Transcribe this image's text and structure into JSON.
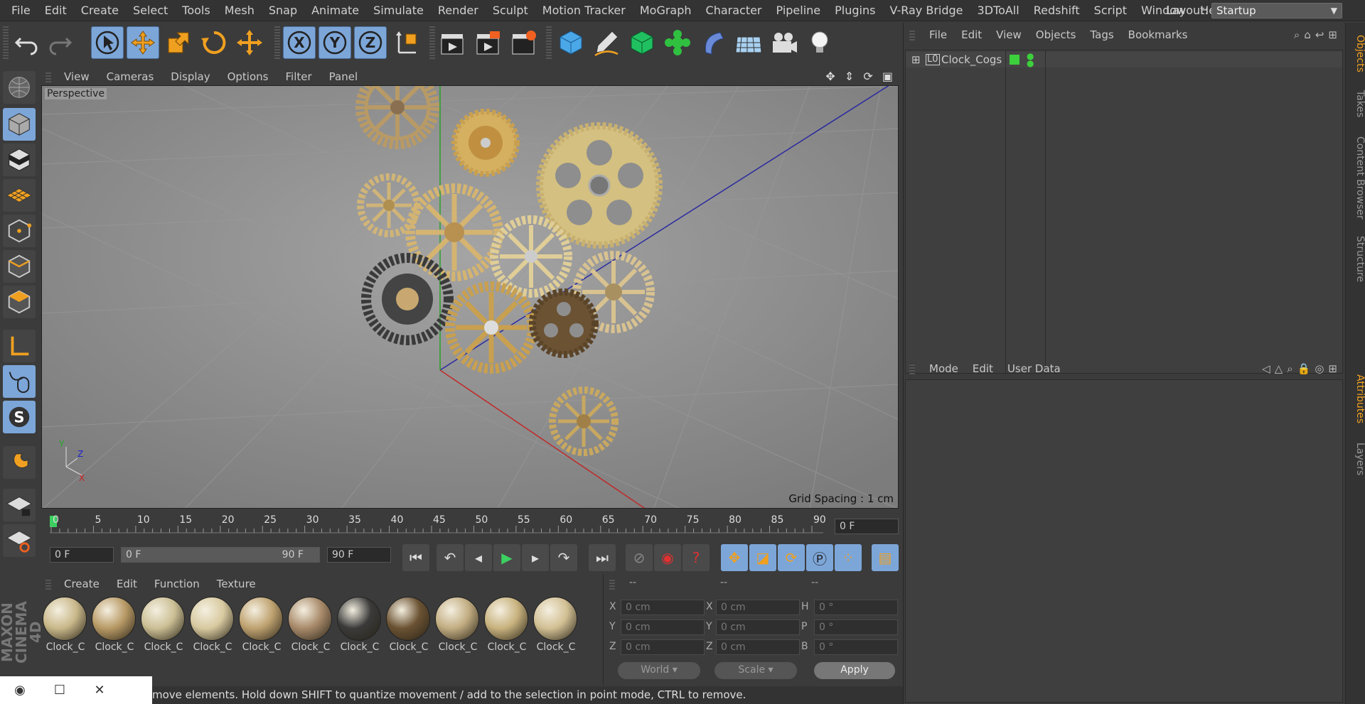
{
  "menubar": {
    "items": [
      "File",
      "Edit",
      "Create",
      "Select",
      "Tools",
      "Mesh",
      "Snap",
      "Animate",
      "Simulate",
      "Render",
      "Sculpt",
      "Motion Tracker",
      "MoGraph",
      "Character",
      "Pipeline",
      "Plugins",
      "V-Ray Bridge",
      "3DToAll",
      "Redshift",
      "Script",
      "Window",
      "Help"
    ],
    "layout_label": "Layout:",
    "layout_value": "Startup"
  },
  "toolbar": {
    "axis_labels": [
      "X",
      "Y",
      "Z"
    ]
  },
  "viewport": {
    "menu": [
      "View",
      "Cameras",
      "Display",
      "Options",
      "Filter",
      "Panel"
    ],
    "title": "Perspective",
    "grid_spacing": "Grid Spacing : 1 cm",
    "axis_labels": [
      "Y",
      "Z",
      "X"
    ]
  },
  "timeline": {
    "ticks": [
      "0",
      "5",
      "10",
      "15",
      "20",
      "25",
      "30",
      "35",
      "40",
      "45",
      "50",
      "55",
      "60",
      "65",
      "70",
      "75",
      "80",
      "85",
      "90"
    ],
    "current_frame": "0 F"
  },
  "transport": {
    "start_field": "0 F",
    "range_start": "0 F",
    "range_end": "90 F",
    "end_field": "90 F"
  },
  "materials": {
    "menu": [
      "Create",
      "Edit",
      "Function",
      "Texture"
    ],
    "items": [
      {
        "label": "Clock_C",
        "color": "#c9b88a"
      },
      {
        "label": "Clock_C",
        "color": "#b89a66"
      },
      {
        "label": "Clock_C",
        "color": "#cbbf95"
      },
      {
        "label": "Clock_C",
        "color": "#d8caa0"
      },
      {
        "label": "Clock_C",
        "color": "#bfa270"
      },
      {
        "label": "Clock_C",
        "color": "#a88a6a"
      },
      {
        "label": "Clock_C",
        "color": "#3a3a3a"
      },
      {
        "label": "Clock_C",
        "color": "#6b5233"
      },
      {
        "label": "Clock_C",
        "color": "#c2ad82"
      },
      {
        "label": "Clock_C",
        "color": "#c8b27e"
      },
      {
        "label": "Clock_C",
        "color": "#d2c094"
      }
    ]
  },
  "coords": {
    "headers": [
      "--",
      "--",
      "--"
    ],
    "rows": [
      {
        "l1": "X",
        "v1": "0 cm",
        "l2": "X",
        "v2": "0 cm",
        "l3": "H",
        "v3": "0 °"
      },
      {
        "l1": "Y",
        "v1": "0 cm",
        "l2": "Y",
        "v2": "0 cm",
        "l3": "P",
        "v3": "0 °"
      },
      {
        "l1": "Z",
        "v1": "0 cm",
        "l2": "Z",
        "v2": "0 cm",
        "l3": "B",
        "v3": "0 °"
      }
    ],
    "world": "World",
    "scale": "Scale",
    "apply": "Apply"
  },
  "status": {
    "text": "move elements. Hold down SHIFT to quantize movement / add to the selection in point mode, CTRL to remove."
  },
  "objects": {
    "menu": [
      "File",
      "Edit",
      "View",
      "Objects",
      "Tags",
      "Bookmarks"
    ],
    "items": [
      {
        "name": "Clock_Cogs",
        "layer_color": "#3cd03c"
      }
    ]
  },
  "attributes": {
    "menu": [
      "Mode",
      "Edit",
      "User Data"
    ]
  },
  "side_tabs": {
    "top": [
      "Objects",
      "Takes",
      "Content Browser",
      "Structure"
    ],
    "bottom": [
      "Attributes",
      "Layers"
    ]
  },
  "logo_text": "MAXON CINEMA 4D"
}
